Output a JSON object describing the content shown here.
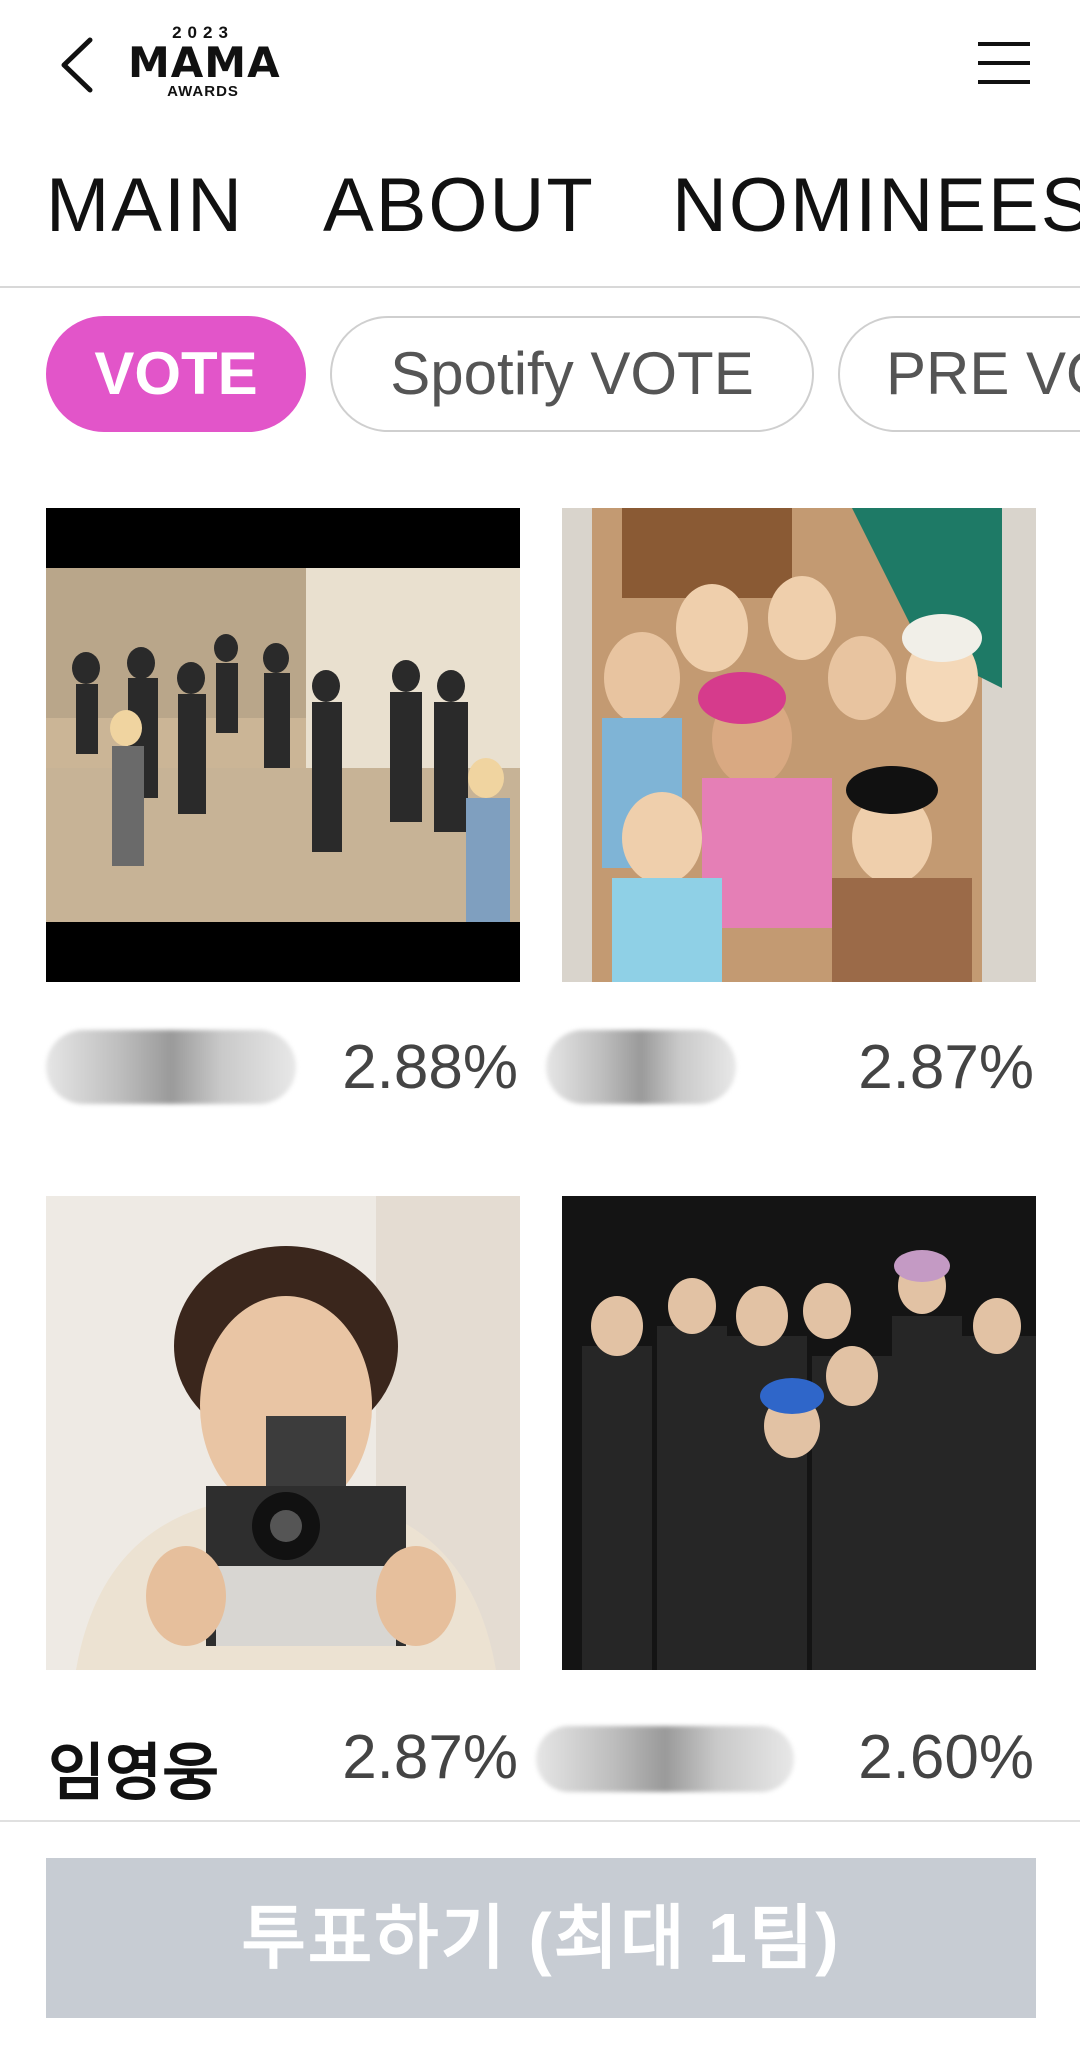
{
  "header": {
    "logo": {
      "year": "2023",
      "name": "MAMA",
      "sub": "AWARDS"
    },
    "back_icon": "chevron-left-icon",
    "menu_icon": "hamburger-menu-icon"
  },
  "tabs": [
    "MAIN",
    "ABOUT",
    "NOMINEES"
  ],
  "filters": [
    {
      "label": "VOTE",
      "active": true
    },
    {
      "label": "Spotify VOTE",
      "active": false
    },
    {
      "label": "PRE VO",
      "active": false
    }
  ],
  "accent_color": "#e255c9",
  "nominees": [
    {
      "name": "",
      "percent": "2.88%"
    },
    {
      "name": "",
      "percent": "2.87%"
    },
    {
      "name": "임영웅",
      "percent": "2.87%"
    },
    {
      "name": "",
      "percent": "2.60%"
    }
  ],
  "vote_button": {
    "label": "투표하기 (최대 1팀)"
  }
}
